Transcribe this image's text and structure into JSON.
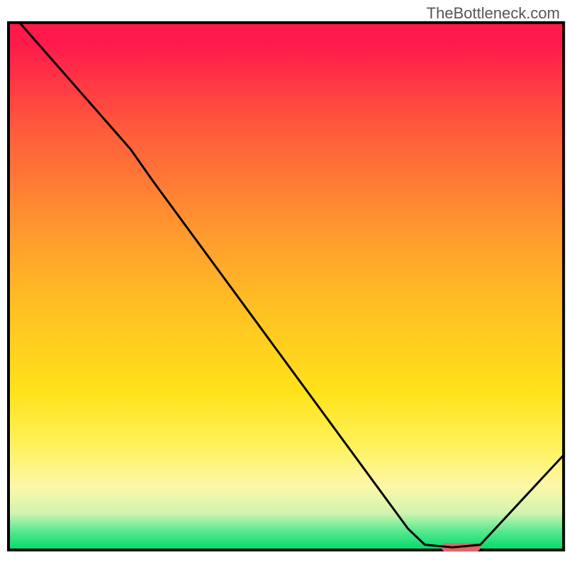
{
  "watermark": "TheBottleneck.com",
  "chart_data": {
    "type": "line",
    "title": "",
    "xlabel": "",
    "ylabel": "",
    "xlim": [
      0,
      100
    ],
    "ylim": [
      0,
      100
    ],
    "grid": false,
    "series": [
      {
        "name": "curve",
        "color": "#000000",
        "points": [
          {
            "x": 2,
            "y": 100
          },
          {
            "x": 22,
            "y": 76
          },
          {
            "x": 26,
            "y": 70
          },
          {
            "x": 72,
            "y": 4
          },
          {
            "x": 75,
            "y": 1
          },
          {
            "x": 80,
            "y": 0.5
          },
          {
            "x": 85,
            "y": 1
          },
          {
            "x": 100,
            "y": 18
          }
        ]
      }
    ],
    "marker": {
      "name": "highlight-segment",
      "color": "#e06666",
      "x_range": [
        78,
        85
      ],
      "y": 0.5,
      "thickness_pct": 1.6
    },
    "gradient_stops": [
      {
        "offset": 0.0,
        "color": "#ff1a4b"
      },
      {
        "offset": 0.04,
        "color": "#ff1a4b"
      },
      {
        "offset": 0.2,
        "color": "#ff5a3c"
      },
      {
        "offset": 0.4,
        "color": "#ff9a2e"
      },
      {
        "offset": 0.55,
        "color": "#ffc223"
      },
      {
        "offset": 0.7,
        "color": "#ffe21a"
      },
      {
        "offset": 0.8,
        "color": "#fff25a"
      },
      {
        "offset": 0.88,
        "color": "#fdf7aa"
      },
      {
        "offset": 0.93,
        "color": "#d1f4b0"
      },
      {
        "offset": 0.965,
        "color": "#55e98f"
      },
      {
        "offset": 1.0,
        "color": "#00d968"
      }
    ],
    "frame": {
      "top_pct": 4.0,
      "left_pct": 1.5,
      "right_pct": 99.4,
      "bottom_pct": 97.0
    }
  }
}
